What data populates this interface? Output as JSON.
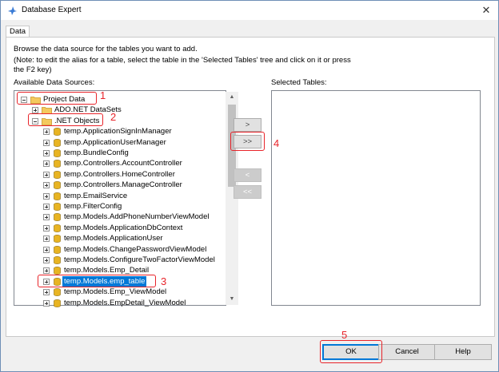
{
  "window": {
    "title": "Database Expert"
  },
  "tabs": [
    {
      "label": "Data"
    }
  ],
  "instructions": {
    "line1": "Browse the data source for the tables you want to add.",
    "line2": "(Note: to edit the alias for a table, select the table in the 'Selected Tables' tree and click on it or press",
    "line3": "the F2 key)"
  },
  "available": {
    "label": "Available Data Sources:",
    "items": [
      {
        "label": "Project Data",
        "kind": "folder",
        "expander": "minus"
      },
      {
        "label": "ADO.NET DataSets",
        "kind": "folder",
        "expander": "plus"
      },
      {
        "label": ".NET Objects",
        "kind": "folder",
        "expander": "minus"
      },
      {
        "label": "temp.ApplicationSignInManager",
        "kind": "table",
        "expander": "plus"
      },
      {
        "label": "temp.ApplicationUserManager",
        "kind": "table",
        "expander": "plus"
      },
      {
        "label": "temp.BundleConfig",
        "kind": "table",
        "expander": "plus"
      },
      {
        "label": "temp.Controllers.AccountController",
        "kind": "table",
        "expander": "plus"
      },
      {
        "label": "temp.Controllers.HomeController",
        "kind": "table",
        "expander": "plus"
      },
      {
        "label": "temp.Controllers.ManageController",
        "kind": "table",
        "expander": "plus"
      },
      {
        "label": "temp.EmailService",
        "kind": "table",
        "expander": "plus"
      },
      {
        "label": "temp.FilterConfig",
        "kind": "table",
        "expander": "plus"
      },
      {
        "label": "temp.Models.AddPhoneNumberViewModel",
        "kind": "table",
        "expander": "plus"
      },
      {
        "label": "temp.Models.ApplicationDbContext",
        "kind": "table",
        "expander": "plus"
      },
      {
        "label": "temp.Models.ApplicationUser",
        "kind": "table",
        "expander": "plus"
      },
      {
        "label": "temp.Models.ChangePasswordViewModel",
        "kind": "table",
        "expander": "plus"
      },
      {
        "label": "temp.Models.ConfigureTwoFactorViewModel",
        "kind": "table",
        "expander": "plus"
      },
      {
        "label": "temp.Models.Emp_Detail",
        "kind": "table",
        "expander": "plus"
      },
      {
        "label": "temp.Models.emp_table",
        "kind": "table",
        "expander": "plus",
        "selected": true
      },
      {
        "label": "temp.Models.Emp_ViewModel",
        "kind": "table",
        "expander": "plus"
      },
      {
        "label": "temp.Models.EmpDetail_ViewModel",
        "kind": "table",
        "expander": "plus"
      }
    ]
  },
  "selected_tables": {
    "label": "Selected Tables:"
  },
  "transfer_buttons": {
    "add_one": ">",
    "add_all": ">>",
    "remove_one": "<",
    "remove_all": "<<"
  },
  "footer": {
    "ok": "OK",
    "cancel": "Cancel",
    "help": "Help"
  },
  "annotations": [
    "1",
    "2",
    "3",
    "4",
    "5"
  ],
  "colors": {
    "selection": "#0078d7",
    "annotation": "#e8242a",
    "folder": "#f4c95d",
    "table_icon": "#e8b422"
  }
}
